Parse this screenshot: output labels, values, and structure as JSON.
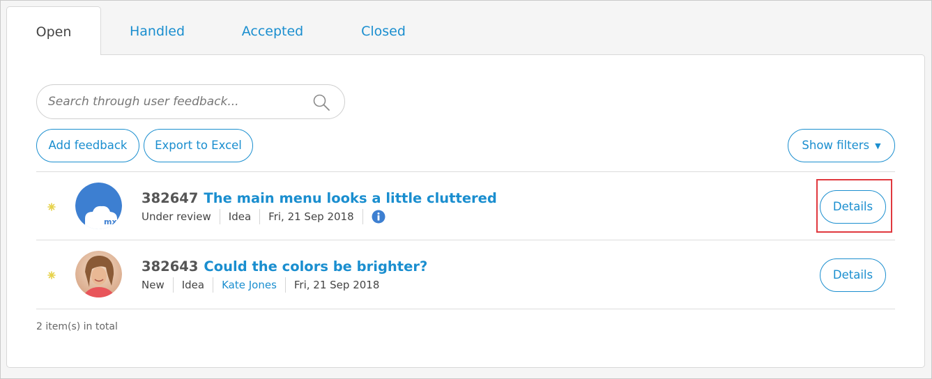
{
  "tabs": [
    {
      "label": "Open",
      "active": true
    },
    {
      "label": "Handled",
      "active": false
    },
    {
      "label": "Accepted",
      "active": false
    },
    {
      "label": "Closed",
      "active": false
    }
  ],
  "search": {
    "placeholder": "Search through user feedback..."
  },
  "actions": {
    "add_feedback": "Add feedback",
    "export_excel": "Export to Excel",
    "show_filters": "Show filters",
    "show_filters_caret": "▼"
  },
  "items": [
    {
      "id": "382647",
      "title": "The main menu looks a little cluttered",
      "status": "Under review",
      "type": "Idea",
      "date": "Fri, 21 Sep 2018",
      "avatar": "mx-logo",
      "avatar_text": "mx",
      "has_info": true,
      "details_label": "Details"
    },
    {
      "id": "382643",
      "title": "Could the colors be brighter?",
      "status": "New",
      "type": "Idea",
      "author": "Kate Jones",
      "date": "Fri, 21 Sep 2018",
      "avatar": "user-photo",
      "details_label": "Details"
    }
  ],
  "total_text": "2 item(s) in total",
  "colors": {
    "accent": "#1a8ecf",
    "highlight": "#e0383e",
    "star": "#e6d24a"
  }
}
